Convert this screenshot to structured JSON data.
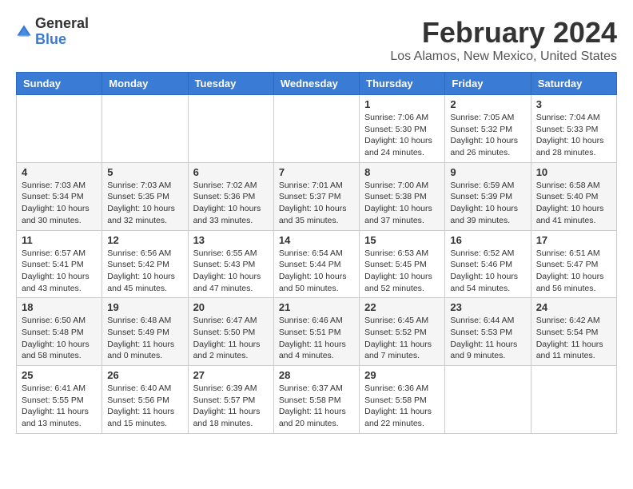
{
  "app": {
    "name_general": "General",
    "name_blue": "Blue"
  },
  "header": {
    "title": "February 2024",
    "subtitle": "Los Alamos, New Mexico, United States"
  },
  "calendar": {
    "days_of_week": [
      "Sunday",
      "Monday",
      "Tuesday",
      "Wednesday",
      "Thursday",
      "Friday",
      "Saturday"
    ],
    "weeks": [
      [
        {
          "day": "",
          "info": ""
        },
        {
          "day": "",
          "info": ""
        },
        {
          "day": "",
          "info": ""
        },
        {
          "day": "",
          "info": ""
        },
        {
          "day": "1",
          "info": "Sunrise: 7:06 AM\nSunset: 5:30 PM\nDaylight: 10 hours\nand 24 minutes."
        },
        {
          "day": "2",
          "info": "Sunrise: 7:05 AM\nSunset: 5:32 PM\nDaylight: 10 hours\nand 26 minutes."
        },
        {
          "day": "3",
          "info": "Sunrise: 7:04 AM\nSunset: 5:33 PM\nDaylight: 10 hours\nand 28 minutes."
        }
      ],
      [
        {
          "day": "4",
          "info": "Sunrise: 7:03 AM\nSunset: 5:34 PM\nDaylight: 10 hours\nand 30 minutes."
        },
        {
          "day": "5",
          "info": "Sunrise: 7:03 AM\nSunset: 5:35 PM\nDaylight: 10 hours\nand 32 minutes."
        },
        {
          "day": "6",
          "info": "Sunrise: 7:02 AM\nSunset: 5:36 PM\nDaylight: 10 hours\nand 33 minutes."
        },
        {
          "day": "7",
          "info": "Sunrise: 7:01 AM\nSunset: 5:37 PM\nDaylight: 10 hours\nand 35 minutes."
        },
        {
          "day": "8",
          "info": "Sunrise: 7:00 AM\nSunset: 5:38 PM\nDaylight: 10 hours\nand 37 minutes."
        },
        {
          "day": "9",
          "info": "Sunrise: 6:59 AM\nSunset: 5:39 PM\nDaylight: 10 hours\nand 39 minutes."
        },
        {
          "day": "10",
          "info": "Sunrise: 6:58 AM\nSunset: 5:40 PM\nDaylight: 10 hours\nand 41 minutes."
        }
      ],
      [
        {
          "day": "11",
          "info": "Sunrise: 6:57 AM\nSunset: 5:41 PM\nDaylight: 10 hours\nand 43 minutes."
        },
        {
          "day": "12",
          "info": "Sunrise: 6:56 AM\nSunset: 5:42 PM\nDaylight: 10 hours\nand 45 minutes."
        },
        {
          "day": "13",
          "info": "Sunrise: 6:55 AM\nSunset: 5:43 PM\nDaylight: 10 hours\nand 47 minutes."
        },
        {
          "day": "14",
          "info": "Sunrise: 6:54 AM\nSunset: 5:44 PM\nDaylight: 10 hours\nand 50 minutes."
        },
        {
          "day": "15",
          "info": "Sunrise: 6:53 AM\nSunset: 5:45 PM\nDaylight: 10 hours\nand 52 minutes."
        },
        {
          "day": "16",
          "info": "Sunrise: 6:52 AM\nSunset: 5:46 PM\nDaylight: 10 hours\nand 54 minutes."
        },
        {
          "day": "17",
          "info": "Sunrise: 6:51 AM\nSunset: 5:47 PM\nDaylight: 10 hours\nand 56 minutes."
        }
      ],
      [
        {
          "day": "18",
          "info": "Sunrise: 6:50 AM\nSunset: 5:48 PM\nDaylight: 10 hours\nand 58 minutes."
        },
        {
          "day": "19",
          "info": "Sunrise: 6:48 AM\nSunset: 5:49 PM\nDaylight: 11 hours\nand 0 minutes."
        },
        {
          "day": "20",
          "info": "Sunrise: 6:47 AM\nSunset: 5:50 PM\nDaylight: 11 hours\nand 2 minutes."
        },
        {
          "day": "21",
          "info": "Sunrise: 6:46 AM\nSunset: 5:51 PM\nDaylight: 11 hours\nand 4 minutes."
        },
        {
          "day": "22",
          "info": "Sunrise: 6:45 AM\nSunset: 5:52 PM\nDaylight: 11 hours\nand 7 minutes."
        },
        {
          "day": "23",
          "info": "Sunrise: 6:44 AM\nSunset: 5:53 PM\nDaylight: 11 hours\nand 9 minutes."
        },
        {
          "day": "24",
          "info": "Sunrise: 6:42 AM\nSunset: 5:54 PM\nDaylight: 11 hours\nand 11 minutes."
        }
      ],
      [
        {
          "day": "25",
          "info": "Sunrise: 6:41 AM\nSunset: 5:55 PM\nDaylight: 11 hours\nand 13 minutes."
        },
        {
          "day": "26",
          "info": "Sunrise: 6:40 AM\nSunset: 5:56 PM\nDaylight: 11 hours\nand 15 minutes."
        },
        {
          "day": "27",
          "info": "Sunrise: 6:39 AM\nSunset: 5:57 PM\nDaylight: 11 hours\nand 18 minutes."
        },
        {
          "day": "28",
          "info": "Sunrise: 6:37 AM\nSunset: 5:58 PM\nDaylight: 11 hours\nand 20 minutes."
        },
        {
          "day": "29",
          "info": "Sunrise: 6:36 AM\nSunset: 5:58 PM\nDaylight: 11 hours\nand 22 minutes."
        },
        {
          "day": "",
          "info": ""
        },
        {
          "day": "",
          "info": ""
        }
      ]
    ]
  }
}
